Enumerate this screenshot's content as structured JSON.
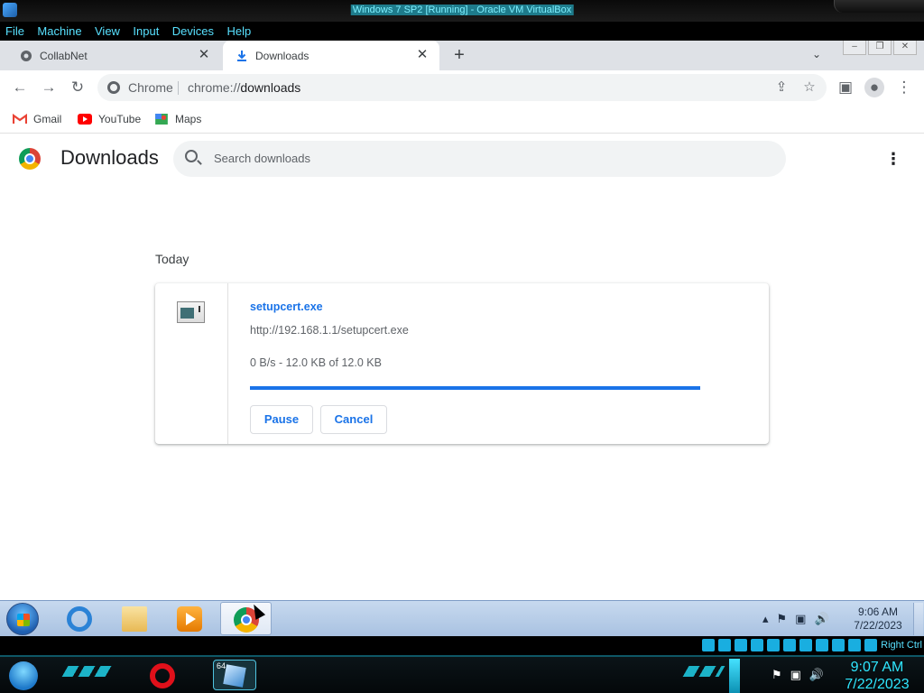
{
  "vbox": {
    "title": "Windows 7 SP2 [Running] - Oracle VM VirtualBox",
    "menu": [
      "File",
      "Machine",
      "View",
      "Input",
      "Devices",
      "Help"
    ]
  },
  "browser": {
    "tabs": [
      {
        "label": "CollabNet",
        "active": false,
        "icon": "collabnet-icon"
      },
      {
        "label": "Downloads",
        "active": true,
        "icon": "download-icon"
      }
    ],
    "new_tab_symbol": "+",
    "omnibox": {
      "site_name": "Chrome",
      "url_scheme": "chrome://",
      "url_path": "downloads"
    },
    "bookmarks": [
      {
        "label": "Gmail",
        "icon": "gmail-icon"
      },
      {
        "label": "YouTube",
        "icon": "youtube-icon"
      },
      {
        "label": "Maps",
        "icon": "maps-icon"
      }
    ]
  },
  "downloads": {
    "title": "Downloads",
    "search_placeholder": "Search downloads",
    "date_heading": "Today",
    "items": [
      {
        "file_name": "setupcert.exe",
        "url": "http://192.168.1.1/setupcert.exe",
        "status": "0 B/s - 12.0 KB of 12.0 KB",
        "progress_fraction": 1.0,
        "pause_label": "Pause",
        "cancel_label": "Cancel"
      }
    ]
  },
  "guest_taskbar": {
    "apps": [
      "internet-explorer",
      "windows-explorer",
      "media-player",
      "google-chrome"
    ],
    "tray_icons": [
      "show-hidden-icons",
      "flag-icon",
      "network-icon",
      "volume-icon"
    ],
    "time": "9:06 AM",
    "date": "7/22/2023"
  },
  "host_statusbar": {
    "host_key": "Right Ctrl"
  },
  "host_taskbar": {
    "time": "9:07 AM",
    "date": "7/22/2023",
    "vbox_badge": "64"
  },
  "colors": {
    "accent": "#1a73e8",
    "tabstrip": "#dee1e6",
    "host_accent": "#2fe7ff"
  }
}
